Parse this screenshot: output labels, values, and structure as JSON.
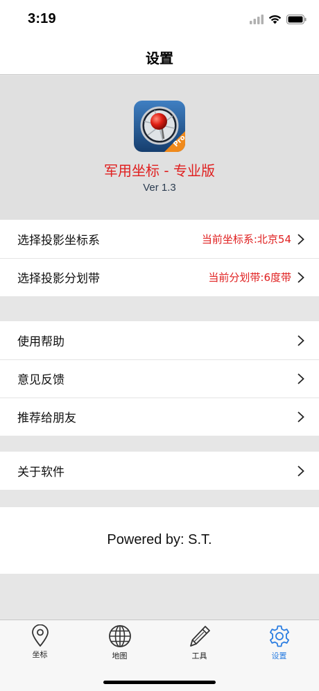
{
  "status_bar": {
    "time": "3:19"
  },
  "nav": {
    "title": "设置"
  },
  "app": {
    "name": "军用坐标 - 专业版",
    "version": "Ver 1.3",
    "badge": "Pro"
  },
  "settings": {
    "coord_system": {
      "label": "选择投影坐标系",
      "value": "当前坐标系:北京54"
    },
    "zone": {
      "label": "选择投影分划带",
      "value": "当前分划带:6度带"
    }
  },
  "misc": {
    "items": [
      {
        "label": "使用帮助"
      },
      {
        "label": "意见反馈"
      },
      {
        "label": "推荐给朋友"
      }
    ]
  },
  "about": {
    "label": "关于软件"
  },
  "footer": {
    "powered": "Powered by: S.T."
  },
  "tabs": [
    {
      "label": "坐标",
      "icon": "location-pin-icon",
      "active": false
    },
    {
      "label": "地图",
      "icon": "globe-icon",
      "active": false
    },
    {
      "label": "工具",
      "icon": "pencil-icon",
      "active": false
    },
    {
      "label": "设置",
      "icon": "gear-icon",
      "active": true
    }
  ],
  "colors": {
    "accent": "#2a7de1",
    "highlight_text": "#e02020",
    "background": "#e6e6e6"
  }
}
